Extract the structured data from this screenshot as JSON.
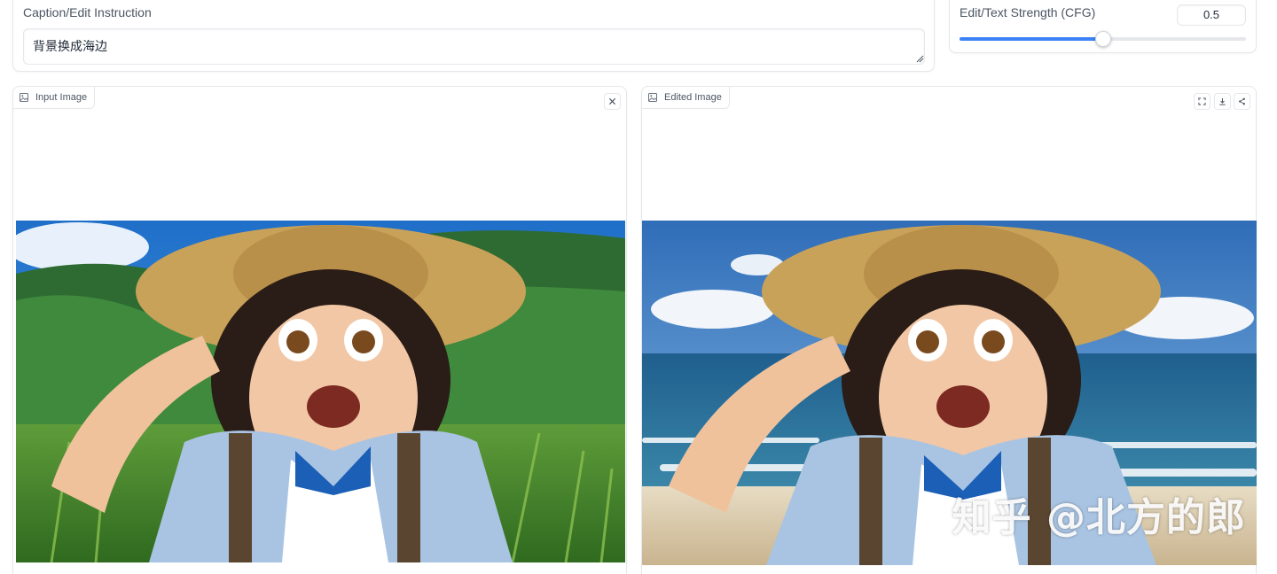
{
  "caption": {
    "label": "Caption/Edit Instruction",
    "value": "背景换成海边"
  },
  "cfg": {
    "label": "Edit/Text Strength (CFG)",
    "value": "0.5",
    "fraction": 0.5
  },
  "input_image": {
    "label": "Input Image",
    "icon": "image-icon",
    "clear_icon": "close-icon"
  },
  "output_image": {
    "label": "Edited Image",
    "icon": "image-icon",
    "actions": [
      "fullscreen-icon",
      "download-icon",
      "share-icon"
    ],
    "watermark": "知乎 @北方的郎"
  },
  "colors": {
    "accent": "#3b82f6",
    "border": "#e5e7eb",
    "label_text": "#4b5563"
  }
}
